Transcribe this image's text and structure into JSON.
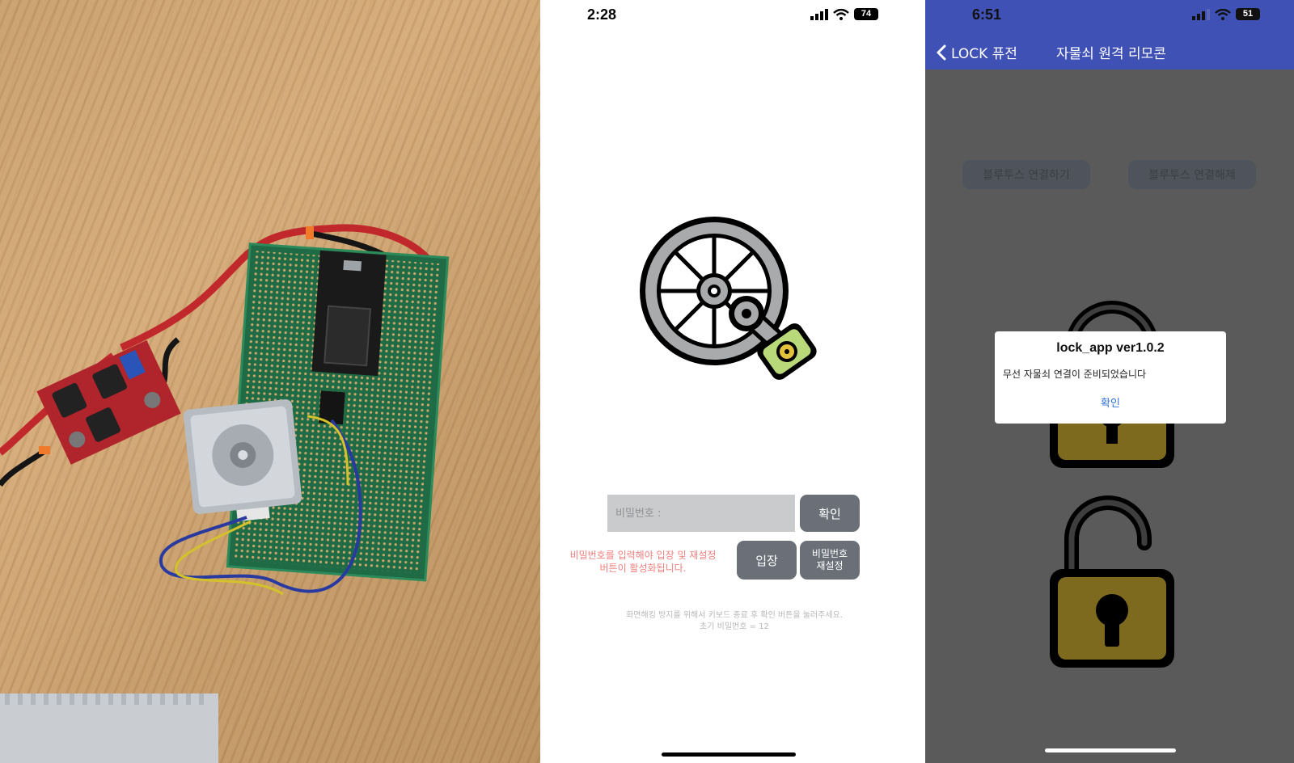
{
  "login_screen": {
    "status_time": "2:28",
    "battery": "74",
    "password_placeholder": "비밀번호 :",
    "confirm_label": "확인",
    "enter_label": "입장",
    "reset_label": "비밀번호\n재설정",
    "warning_text": "비밀번호를 입력해야 입장 및 재설정\n버튼이 활성화됩니다.",
    "hint_text": "화면해킹 방지를 위해서 키보드 종료 후 확인 버튼을 눌러주세요.\n초기 비밀번호 = 12"
  },
  "remote_screen": {
    "status_time": "6:51",
    "battery": "51",
    "back_label": "LOCK 퓨전",
    "title": "자물쇠 원격 리모콘",
    "bt_connect_label": "블루투스 연결하기",
    "bt_disconnect_label": "블루투스 연결해제",
    "alert": {
      "title": "lock_app ver1.0.2",
      "message": "무선 자물쇠 연결이 준비되었습니다",
      "ok_label": "확인"
    }
  },
  "colors": {
    "header_blue": "#3f51b5",
    "remote_bg": "#5a5a5a",
    "button_gray": "#6b7078",
    "lock_body": "#7d6a1e",
    "warning_red": "#f08080",
    "alert_link": "#2f6fd8"
  },
  "icons": [
    "wheel-lock-logo-icon",
    "lock-icon",
    "unlock-icon",
    "back-chevron-icon",
    "signal-icon",
    "wifi-icon",
    "battery-icon"
  ]
}
